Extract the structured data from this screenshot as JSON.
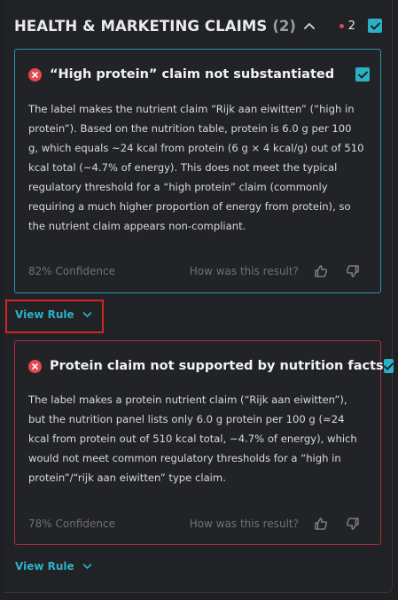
{
  "section": {
    "title": "HEALTH & MARKETING CLAIMS",
    "count": "(2)",
    "issue_count": "2",
    "colors": {
      "accent": "#2eb1c6",
      "error": "#e5484d",
      "error_border": "#a8303a",
      "info_border": "#2d97a9"
    }
  },
  "cards": [
    {
      "title": "“High protein” claim not substantiated",
      "body": "The label makes the nutrient claim “Rijk aan eiwitten” (“high in protein”). Based on the nutrition table, protein is 6.0 g per 100 g, which equals ~24 kcal from protein (6 g × 4 kcal/g) out of 510 kcal total (~4.7% of energy). This does not meet the typical regulatory threshold for a “high protein” claim (commonly requiring a much higher proportion of energy from protein), so the nutrient claim appears non-compliant.",
      "confidence": "82% Confidence",
      "feedback_question": "How was this result?",
      "view_rule": "View Rule"
    },
    {
      "title": "Protein claim not supported by nutrition facts",
      "body": "The label makes a protein nutrient claim (“Rijk aan eiwitten”), but the nutrition panel lists only 6.0 g protein per 100 g (≈24 kcal from protein out of 510 kcal total, ~4.7% of energy), which would not meet common regulatory thresholds for a “high in protein”/“rijk aan eiwitten” type claim.",
      "confidence": "78% Confidence",
      "feedback_question": "How was this result?",
      "view_rule": "View Rule"
    }
  ]
}
